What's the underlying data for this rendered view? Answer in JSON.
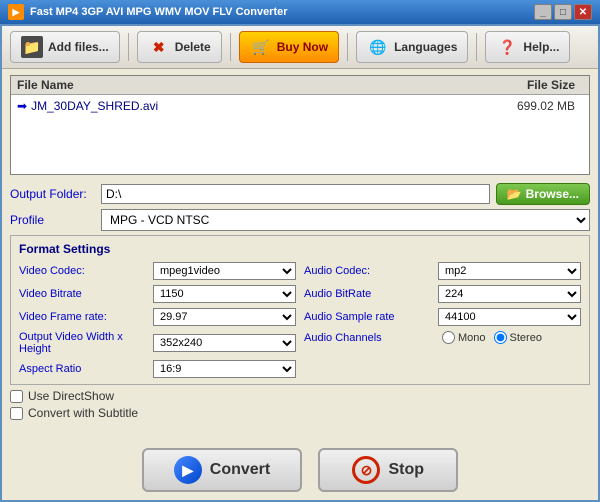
{
  "window": {
    "title": "Fast MP4 3GP AVI MPG WMV MOV FLV Converter",
    "controls": [
      "minimize",
      "maximize",
      "close"
    ]
  },
  "toolbar": {
    "add_label": "Add files...",
    "delete_label": "Delete",
    "buynow_label": "Buy Now",
    "languages_label": "Languages",
    "help_label": "Help..."
  },
  "filelist": {
    "col_name": "File Name",
    "col_size": "File Size",
    "files": [
      {
        "name": "JM_30DAY_SHRED.avi",
        "size": "699.02 MB"
      }
    ]
  },
  "output": {
    "folder_label": "Output Folder:",
    "folder_value": "D:\\",
    "browse_label": "Browse...",
    "profile_label": "Profile",
    "profile_value": "MPG - VCD NTSC"
  },
  "format_settings": {
    "title": "Format Settings",
    "video_codec_label": "Video Codec:",
    "video_codec_value": "mpeg1video",
    "video_bitrate_label": "Video Bitrate",
    "video_bitrate_value": "1150",
    "video_framerate_label": "Video Frame rate:",
    "video_framerate_value": "29.97",
    "video_size_label": "Output Video Width x Height",
    "video_size_value": "352x240",
    "aspect_ratio_label": "Aspect Ratio",
    "aspect_ratio_value": "16:9",
    "audio_codec_label": "Audio Codec:",
    "audio_codec_value": "mp2",
    "audio_bitrate_label": "Audio BitRate",
    "audio_bitrate_value": "224",
    "audio_samplerate_label": "Audio Sample rate",
    "audio_samplerate_value": "44100",
    "audio_channels_label": "Audio Channels",
    "audio_channels_options": [
      "Mono",
      "Stereo"
    ],
    "audio_channels_selected": "Stereo"
  },
  "options": {
    "use_directshow_label": "Use DirectShow",
    "convert_subtitle_label": "Convert with Subtitle"
  },
  "actions": {
    "convert_label": "Convert",
    "stop_label": "Stop"
  }
}
